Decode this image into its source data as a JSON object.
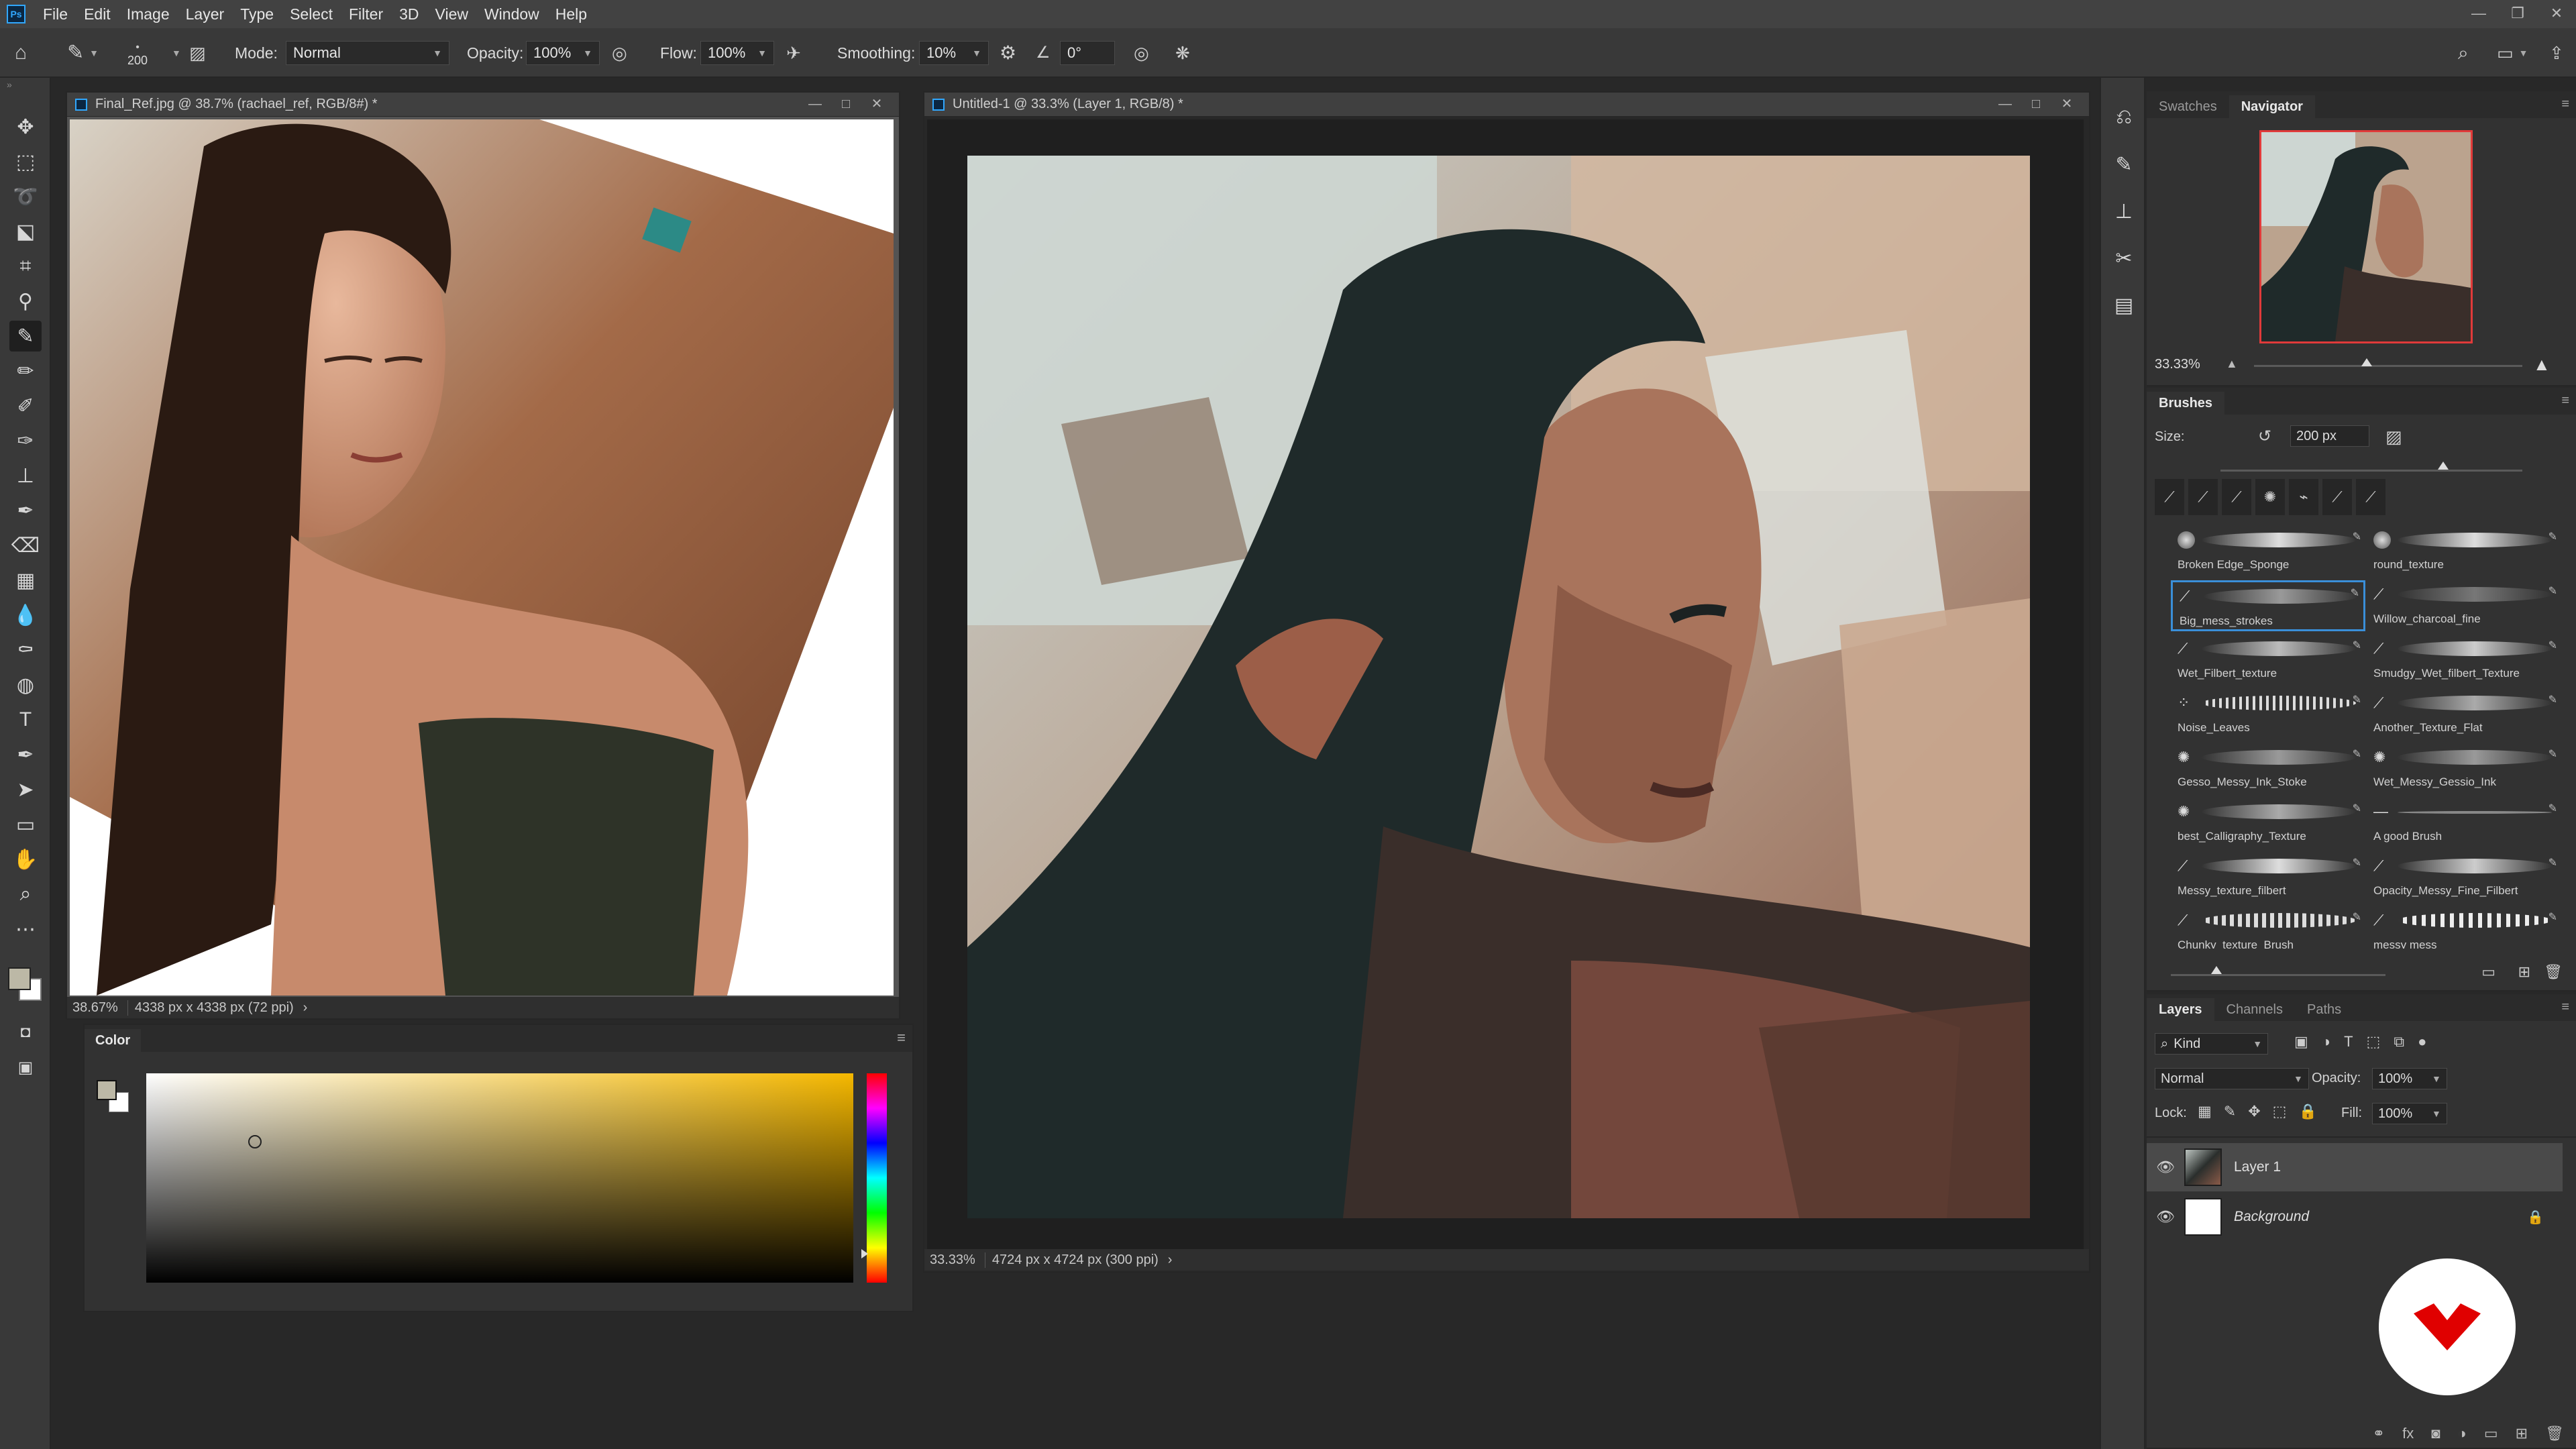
{
  "menubar": {
    "items": [
      "File",
      "Edit",
      "Image",
      "Layer",
      "Type",
      "Select",
      "Filter",
      "3D",
      "View",
      "Window",
      "Help"
    ],
    "logo": "Ps"
  },
  "options": {
    "brush_size": "200",
    "mode_label": "Mode:",
    "mode_value": "Normal",
    "opacity_label": "Opacity:",
    "opacity_value": "100%",
    "flow_label": "Flow:",
    "flow_value": "100%",
    "smoothing_label": "Smoothing:",
    "smoothing_value": "10%",
    "angle_value": "0°"
  },
  "ref_window": {
    "title": "Final_Ref.jpg @ 38.7% (rachael_ref, RGB/8#) *",
    "zoom": "38.67%",
    "dimensions": "4338 px x 4338 px (72 ppi)"
  },
  "color_panel": {
    "title": "Color"
  },
  "main_window": {
    "title": "Untitled-1 @ 33.3% (Layer 1, RGB/8) *",
    "zoom": "33.33%",
    "dimensions": "4724 px x 4724 px (300 ppi)"
  },
  "navigator": {
    "tabs": [
      "Swatches",
      "Navigator"
    ],
    "active_tab": "Navigator",
    "zoom": "33.33%"
  },
  "brushes": {
    "title": "Brushes",
    "size_label": "Size:",
    "size_value": "200 px",
    "items": [
      "Broken Edge_Sponge",
      "round_texture",
      "Big_mess_strokes",
      "Willow_charcoal_fine",
      "Wet_Filbert_texture",
      "Smudgy_Wet_filbert_Texture",
      "Noise_Leaves",
      "Another_Texture_Flat",
      "Gesso_Messy_Ink_Stoke",
      "Wet_Messy_Gessio_Ink",
      "best_Calligraphy_Texture",
      "A good Brush",
      "Messy_texture_filbert",
      "Opacity_Messy_Fine_Filbert",
      "Chunky_texture_Brush",
      "messy mess"
    ],
    "selected": "Big_mess_strokes"
  },
  "layers": {
    "tabs": [
      "Layers",
      "Channels",
      "Paths"
    ],
    "active_tab": "Layers",
    "kind_label": "Kind",
    "blend_mode": "Normal",
    "opacity_label": "Opacity:",
    "opacity_value": "100%",
    "lock_label": "Lock:",
    "fill_label": "Fill:",
    "fill_value": "100%",
    "items": [
      {
        "name": "Layer 1",
        "selected": true
      },
      {
        "name": "Background",
        "locked": true
      }
    ]
  },
  "colors": {
    "accent": "#31a8ff",
    "selection": "#3a8fd9",
    "brand_badge": "#e00000"
  }
}
